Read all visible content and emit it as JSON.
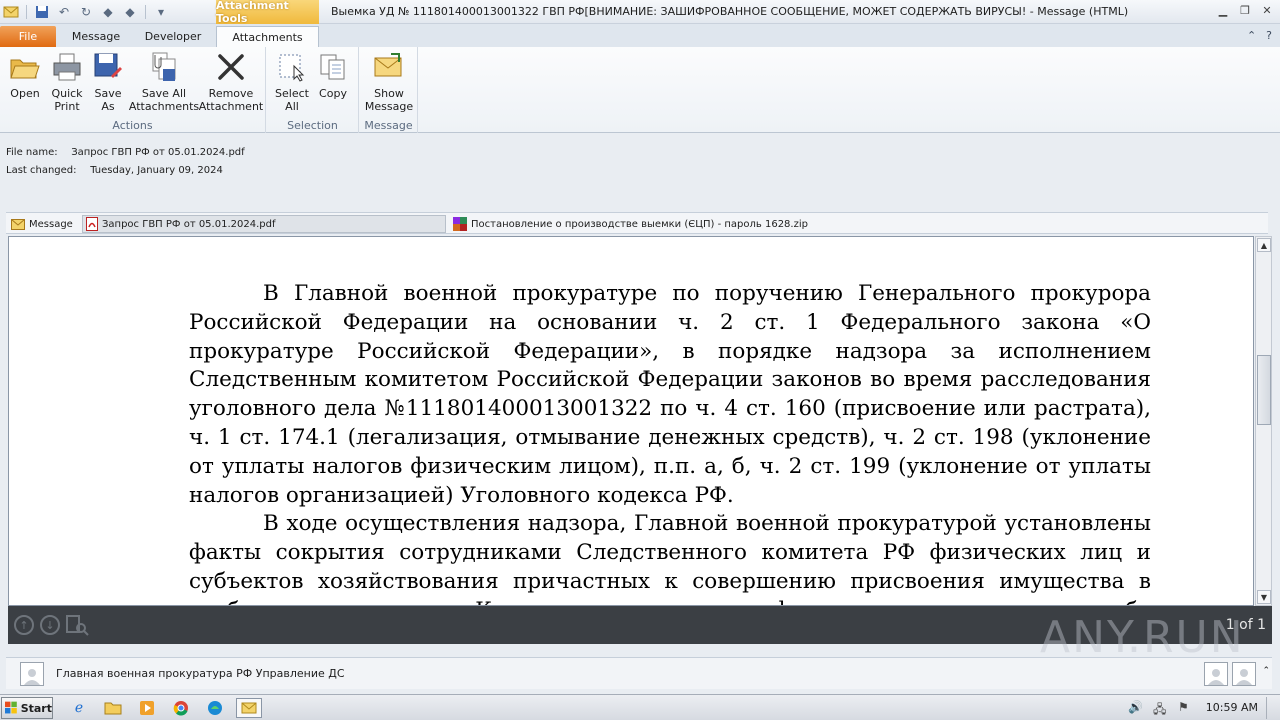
{
  "window": {
    "contextual_tab": "Attachment Tools",
    "title": "Выемка УД № 11180140001300132​2  ГВП РФ[ВНИМАНИЕ: ЗАШИФРОВАННОЕ СООБЩЕНИЕ, МОЖЕТ СОДЕРЖАТЬ ВИРУСЫ! -  Message (HTML)"
  },
  "tabs": [
    "File",
    "Message",
    "Developer",
    "Attachments"
  ],
  "ribbon": {
    "groups": [
      {
        "label": "Actions",
        "buttons": [
          "Open",
          "Quick\nPrint",
          "Save\nAs",
          "Save All\nAttachments",
          "Remove\nAttachment"
        ]
      },
      {
        "label": "Selection",
        "buttons": [
          "Select\nAll",
          "Copy"
        ]
      },
      {
        "label": "Message",
        "buttons": [
          "Show\nMessage"
        ]
      }
    ]
  },
  "file_info": {
    "name_label": "File name:",
    "name_value": "Запрос ГВП РФ от 05.01.2024.pdf",
    "changed_label": "Last changed:",
    "changed_value": "Tuesday, January 09, 2024"
  },
  "attachments": [
    {
      "label": "Message",
      "icon": "envelope-icon"
    },
    {
      "label": "Запрос ГВП РФ от 05.01.2024.pdf",
      "icon": "pdf-icon"
    },
    {
      "label": "Постановление о производстве выемки (ЄЦП) - пароль 1628.zip",
      "icon": "zip-icon"
    }
  ],
  "document": {
    "p1": "В Главной военной прокуратуре по поручению Генерального прокурора Российской Федерации на основании ч. 2 ст. 1 Федерального закона «О прокуратуре Российской Федерации», в порядке надзора за исполнением Следственным комитетом Российской Федерации законов во время расследования уголовного дела №11180140001300132​2 по ч. 4 ст. 160 (присвоение или растрата), ч. 1 ст. 174.1 (легализация, отмывание денежных средств), ч. 2 ст. 198 (уклонение от уплаты налогов физическим лицом), п.п. а, б, ч. 2 ст. 199 (уклонение от уплаты налогов организацией) Уголовного кодекса РФ.",
    "p2": "В ходе осуществления надзора, Главной военной прокуратурой установлены факты сокрытия сотрудниками Следственного комитета РФ физических лиц и субъектов хозяйствования причастных к совершению присвоения имущества в особо крупном размере. Кроме того, установлены факты получения взяток в особо крупном размере"
  },
  "pager": {
    "text": "1 of 1"
  },
  "watermark": "ANY.RUN",
  "people": {
    "name": "Главная военная прокуратура РФ Управление ДС"
  },
  "taskbar": {
    "start": "Start",
    "clock": "10:59 AM"
  },
  "colors": {
    "file_tab": "#e06a12",
    "contextual": "#f0b93c",
    "navbar": "#3b3f44"
  }
}
